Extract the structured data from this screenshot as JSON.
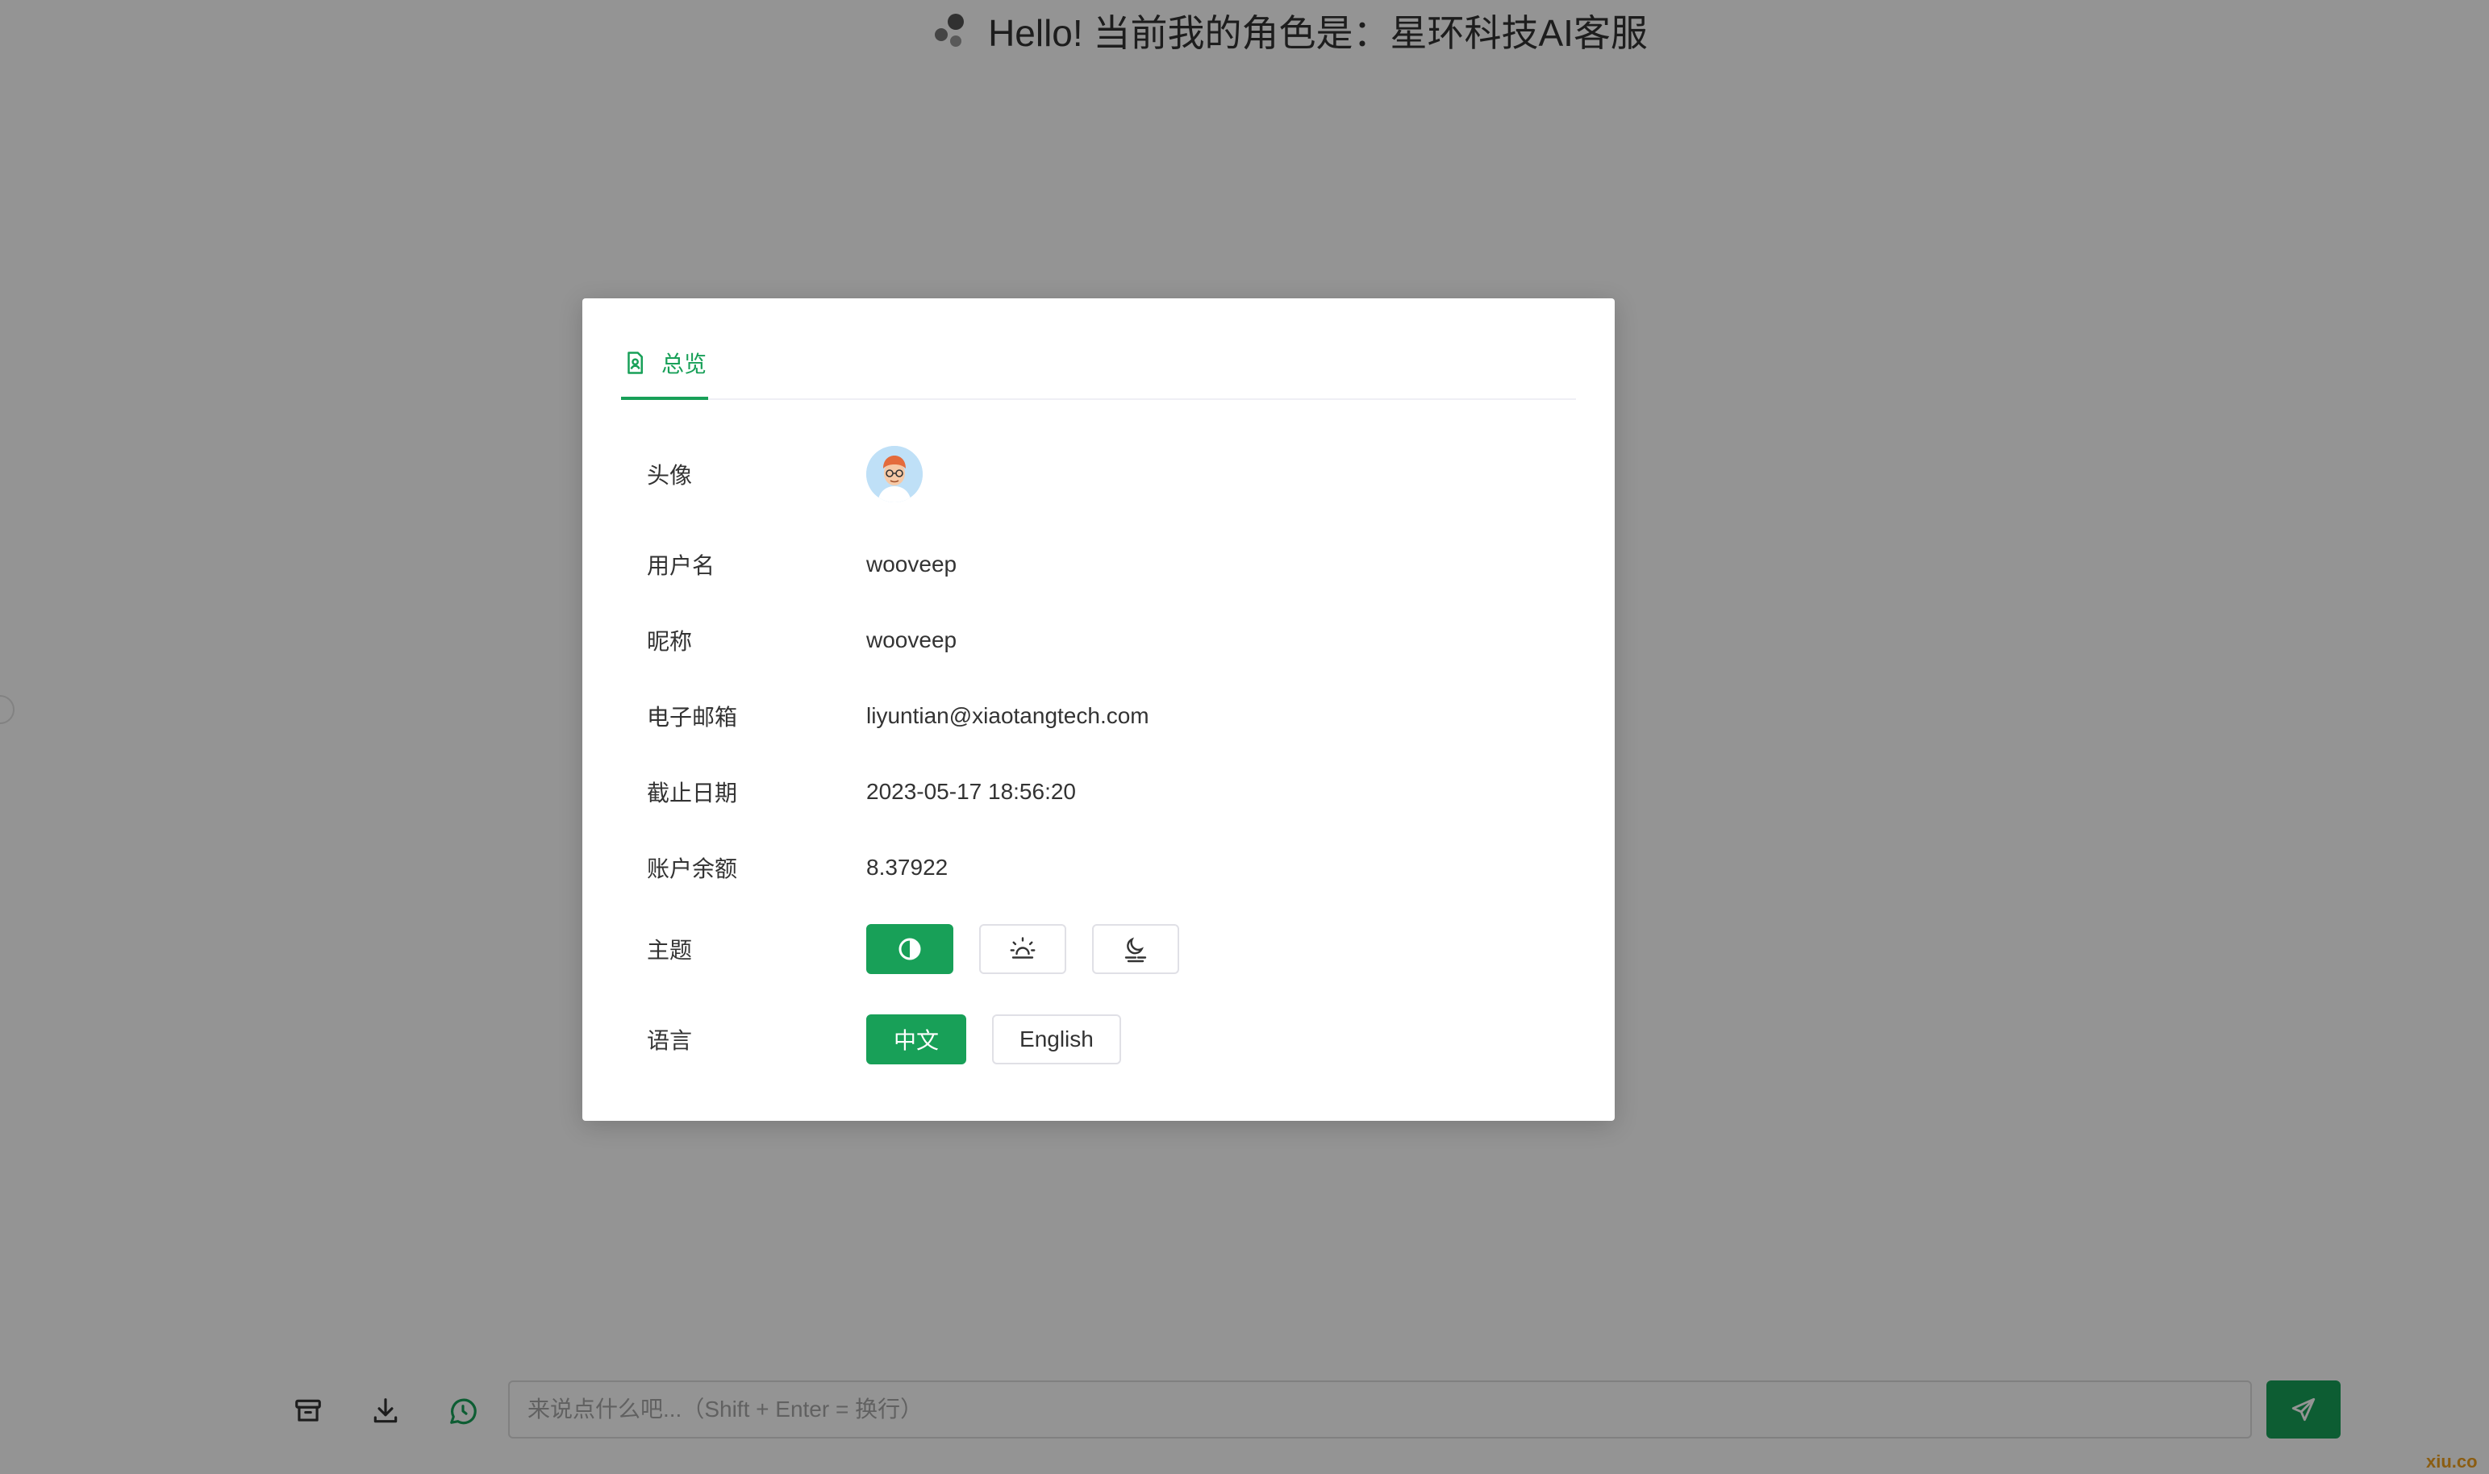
{
  "header": {
    "title": "Hello! 当前我的角色是：星环科技AI客服",
    "role_icon": "bubbles-icon"
  },
  "input_bar": {
    "icons": [
      "archive-icon",
      "download-icon",
      "whatsapp-icon"
    ],
    "placeholder": "来说点什么吧...（Shift + Enter = 换行）",
    "send_icon": "send-icon"
  },
  "modal": {
    "tab": {
      "label": "总览",
      "icon": "document-user-icon"
    },
    "rows": {
      "avatar_label": "头像",
      "username_label": "用户名",
      "username_value": "wooveep",
      "nickname_label": "昵称",
      "nickname_value": "wooveep",
      "email_label": "电子邮箱",
      "email_value": "liyuntian@xiaotangtech.com",
      "expiry_label": "截止日期",
      "expiry_value": "2023-05-17 18:56:20",
      "balance_label": "账户余额",
      "balance_value": "8.37922",
      "theme_label": "主题",
      "theme_options": [
        "auto-contrast-icon",
        "sun-icon",
        "moon-icon"
      ],
      "theme_selected": "auto-contrast-icon",
      "language_label": "语言",
      "language_options": [
        "中文",
        "English"
      ],
      "language_selected": "中文"
    }
  },
  "watermark": "xiu.co",
  "colors": {
    "accent": "#18a058",
    "overlay": "rgba(0,0,0,0.42)",
    "text": "#333333"
  }
}
